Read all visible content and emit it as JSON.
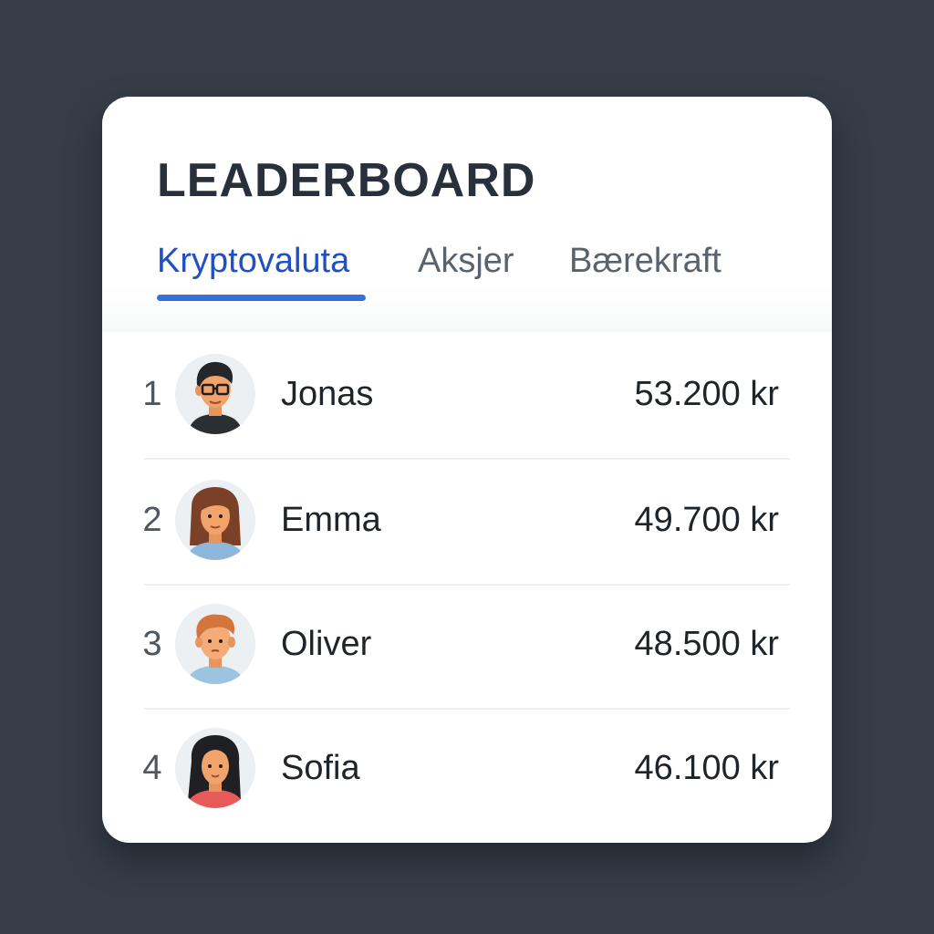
{
  "title": "LEADERBOARD",
  "tabs": [
    {
      "label": "Kryptovaluta",
      "active": true
    },
    {
      "label": "Aksjer",
      "active": false
    },
    {
      "label": "Bærekraft",
      "active": false
    }
  ],
  "colors": {
    "accent": "#3570db",
    "active_tab_text": "#2150c2",
    "background": "#363d47"
  },
  "entries": [
    {
      "rank": "1",
      "name": "Jonas",
      "amount": "53.200 kr",
      "avatar_icon": "man-with-glasses-avatar-icon"
    },
    {
      "rank": "2",
      "name": "Emma",
      "amount": "49.700 kr",
      "avatar_icon": "woman-brown-hair-avatar-icon"
    },
    {
      "rank": "3",
      "name": "Oliver",
      "amount": "48.500 kr",
      "avatar_icon": "man-red-hair-avatar-icon"
    },
    {
      "rank": "4",
      "name": "Sofia",
      "amount": "46.100 kr",
      "avatar_icon": "woman-black-hair-avatar-icon"
    }
  ]
}
